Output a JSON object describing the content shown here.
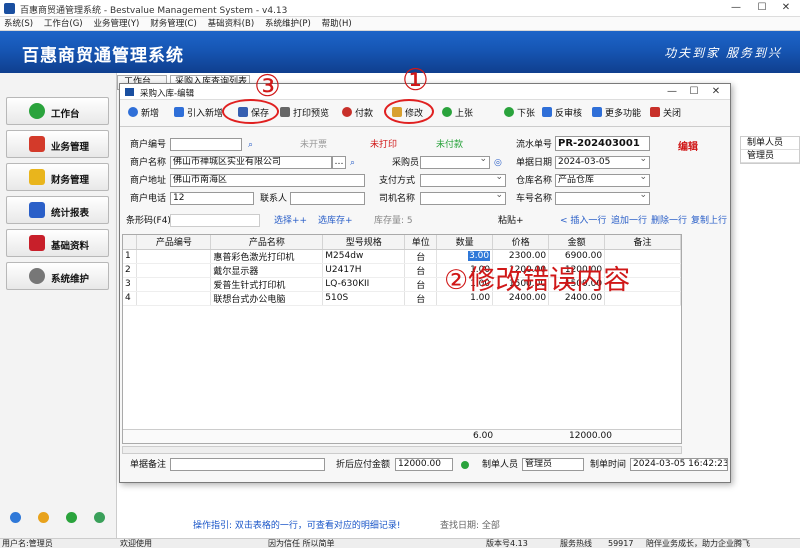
{
  "window": {
    "title": "百惠商贸通管理系统 - Bestvalue Management System - v4.13",
    "controls": [
      "—",
      "☐",
      "✕"
    ]
  },
  "menu": [
    "系统(S)",
    "工作台(G)",
    "业务管理(Y)",
    "财务管理(C)",
    "基础资料(B)",
    "系统维护(P)",
    "帮助(H)"
  ],
  "banner": {
    "app_name": "百惠商贸通管理系统",
    "slogan": "功夫到家  服务到兴"
  },
  "sidebar": {
    "items": [
      {
        "label": "工作台",
        "icon": "check-circle-icon",
        "color": "#2aa33c"
      },
      {
        "label": "业务管理",
        "icon": "house-icon",
        "color": "#d33a2a"
      },
      {
        "label": "财务管理",
        "icon": "folder-icon",
        "color": "#e9b51c"
      },
      {
        "label": "统计报表",
        "icon": "bar-chart-icon",
        "color": "#2a5fc8"
      },
      {
        "label": "基础资料",
        "icon": "book-icon",
        "color": "#c81f2a"
      },
      {
        "label": "系统维护",
        "icon": "gear-icon",
        "color": "#777777"
      }
    ]
  },
  "tabs": {
    "workbench": "工作台",
    "purchase": "采购入库查询列表"
  },
  "background_grid": {
    "col1": "制单人员",
    "val1": "管理员"
  },
  "background_status": {
    "hint": "操作指引: 双击表格的一行，可查看对应的明细记录!",
    "date": "查找日期: 全部"
  },
  "statusbar": {
    "user": "用户名:管理员",
    "welcome": "欢迎使用",
    "motto": "因为信任 所以简单",
    "version": "版本号4.13",
    "service": "服务热线",
    "phone": "59917",
    "tagline": "陪伴业务成长，助力企业腾飞"
  },
  "dialog": {
    "title": "采购入库-编辑",
    "toolbar": [
      "新增",
      "引入新增",
      "保存",
      "打印预览",
      "付款",
      "修改",
      "上张",
      "下张",
      "反审核",
      "更多功能",
      "关闭"
    ],
    "form": {
      "merchant_code_label": "商户编号",
      "invoice_status": "未开票",
      "print_status": "未打印",
      "pay_status": "未付款",
      "serial_label": "流水单号",
      "serial_value": "PR-202403001",
      "edit_flag": "编辑",
      "merchant_name_label": "商户名称",
      "merchant_name_value": "佛山市禅城区实业有限公司",
      "buyer_label": "采购员",
      "date_label": "单据日期",
      "date_value": "2024-03-05",
      "address_label": "商户地址",
      "address_value": "佛山市南海区",
      "pay_method_label": "支付方式",
      "warehouse_label": "仓库名称",
      "warehouse_value": "产品仓库",
      "phone_label": "商户电话",
      "phone_value": "12",
      "contact_label": "联系人",
      "driver_label": "司机名称",
      "plate_label": "车号名称"
    },
    "barcode_bar": {
      "barcode_label": "条形码(F4)",
      "select_enter": "选择++",
      "select_stock": "选库存+",
      "stock_qty": "库存量: 5",
      "paste": "粘贴+",
      "insert_row": "< 插入一行",
      "append_row": "追加一行",
      "delete_row": "删除一行",
      "copy_row": "复制上行"
    },
    "grid": {
      "headers": [
        "",
        "产品编号",
        "产品名称",
        "型号规格",
        "单位",
        "数量",
        "价格",
        "金额",
        "备注"
      ],
      "rows": [
        {
          "n": "1",
          "code": "",
          "name": "惠普彩色激光打印机",
          "model": "M254dw",
          "unit": "台",
          "qty": "3.00",
          "price": "2300.00",
          "amount": "6900.00",
          "note": ""
        },
        {
          "n": "2",
          "code": "",
          "name": "戴尔显示器",
          "model": "U2417H",
          "unit": "台",
          "qty": "1.00",
          "price": "1200.00",
          "amount": "1200.00",
          "note": ""
        },
        {
          "n": "3",
          "code": "",
          "name": "爱普生针式打印机",
          "model": "LQ-630KII",
          "unit": "台",
          "qty": "1.00",
          "price": "1500.00",
          "amount": "1500.00",
          "note": ""
        },
        {
          "n": "4",
          "code": "",
          "name": "联想台式办公电脑",
          "model": "510S",
          "unit": "台",
          "qty": "1.00",
          "price": "2400.00",
          "amount": "2400.00",
          "note": ""
        }
      ],
      "total_qty": "6.00",
      "total_amount": "12000.00"
    },
    "footer": {
      "remark_label": "单据备注",
      "discount_label": "折后应付金额",
      "discount_value": "12000.00",
      "maker_label": "制单人员",
      "maker_value": "管理员",
      "time_label": "制单时间",
      "time_value": "2024-03-05 16:42:23"
    }
  },
  "annotations": {
    "n1": "①",
    "n2_text": "②修改错误内容",
    "n3": "③"
  }
}
